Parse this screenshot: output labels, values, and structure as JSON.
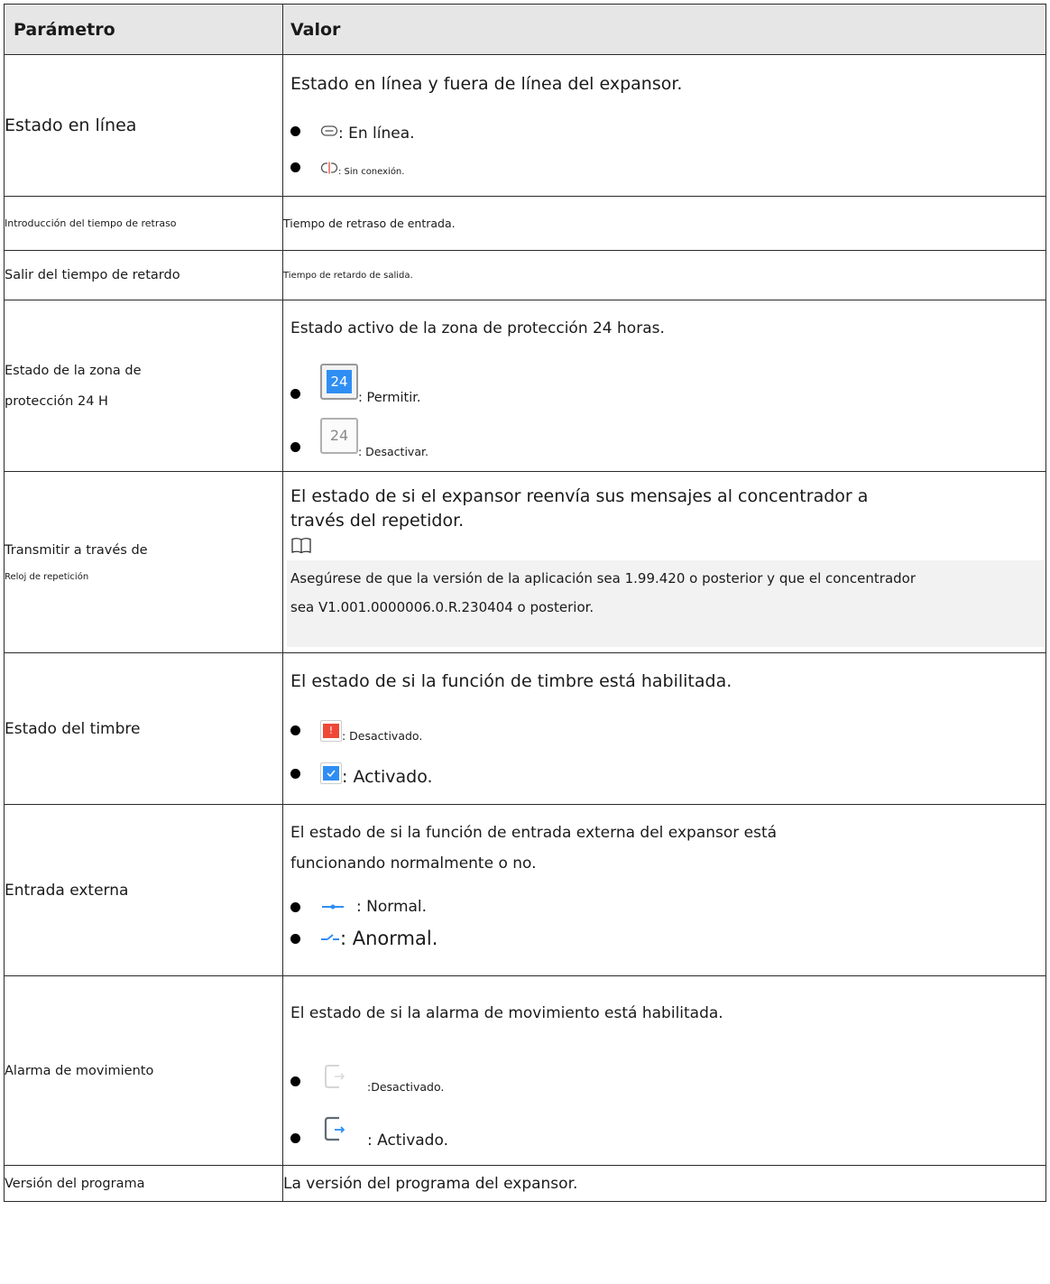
{
  "table": {
    "header": {
      "param": "Parámetro",
      "value": "Valor"
    },
    "row_online": {
      "param": "Estado en línea",
      "desc": "Estado en línea y fuera de línea del expansor.",
      "item1_icon": "link-connected-icon",
      "item1": ": En línea.",
      "item2_icon": "link-broken-icon",
      "item2": ": Sin conexión."
    },
    "row_entry_delay": {
      "param": "Introducción del tiempo de retraso",
      "value": "Tiempo de retraso de entrada."
    },
    "row_exit_delay": {
      "param": "Salir del tiempo de retardo",
      "value": "Tiempo de retardo de salida."
    },
    "row_24h": {
      "param_line1": "Estado de la zona de",
      "param_line2": "protección 24 H",
      "desc": "Estado activo de la zona de protección 24 horas.",
      "badge_on": "24",
      "item1": ": Permitir.",
      "badge_off": "24",
      "item2": ": Desactivar."
    },
    "row_repeater": {
      "param_line1": "Transmitir a través de",
      "param_line2": "Reloj de repetición",
      "desc_line1": "El estado de si el expansor reenvía sus mensajes al concentrador a",
      "desc_line2": "través del repetidor.",
      "note_icon": "book-icon",
      "note_line1": "Asegúrese de que la versión de la aplicación sea 1.99.420 o posterior y que el concentrador",
      "note_line2": "sea V1.001.0000006.0.R.230404 o posterior."
    },
    "row_buzzer": {
      "param": "Estado del timbre",
      "desc": "El estado de si la función de timbre está habilitada.",
      "item1_icon": "alert-square-icon",
      "item1": ": Desactivado.",
      "item2_icon": "check-square-icon",
      "item2": ": Activado."
    },
    "row_external": {
      "param": "Entrada externa",
      "desc_line1": "El estado de si la función de entrada externa del expansor está",
      "desc_line2": "funcionando normalmente o no.",
      "item1_icon": "closed-switch-icon",
      "item1": ": Normal.",
      "item2_icon": "open-switch-icon",
      "item2": ": Anormal."
    },
    "row_motion": {
      "param": "Alarma de movimiento",
      "desc": "El estado de si la alarma de movimiento está habilitada.",
      "item1_icon": "exit-disabled-icon",
      "item1": ":Desactivado.",
      "item2_icon": "exit-enabled-icon",
      "item2": ": Activado."
    },
    "row_version": {
      "param": "Versión del programa",
      "value": "La versión del programa del expansor."
    }
  },
  "colors": {
    "header_bg": "#e6e6e6",
    "note_bg": "#f2f2f2",
    "accent_blue": "#2f8ef4",
    "alert_red": "#ef4836"
  }
}
